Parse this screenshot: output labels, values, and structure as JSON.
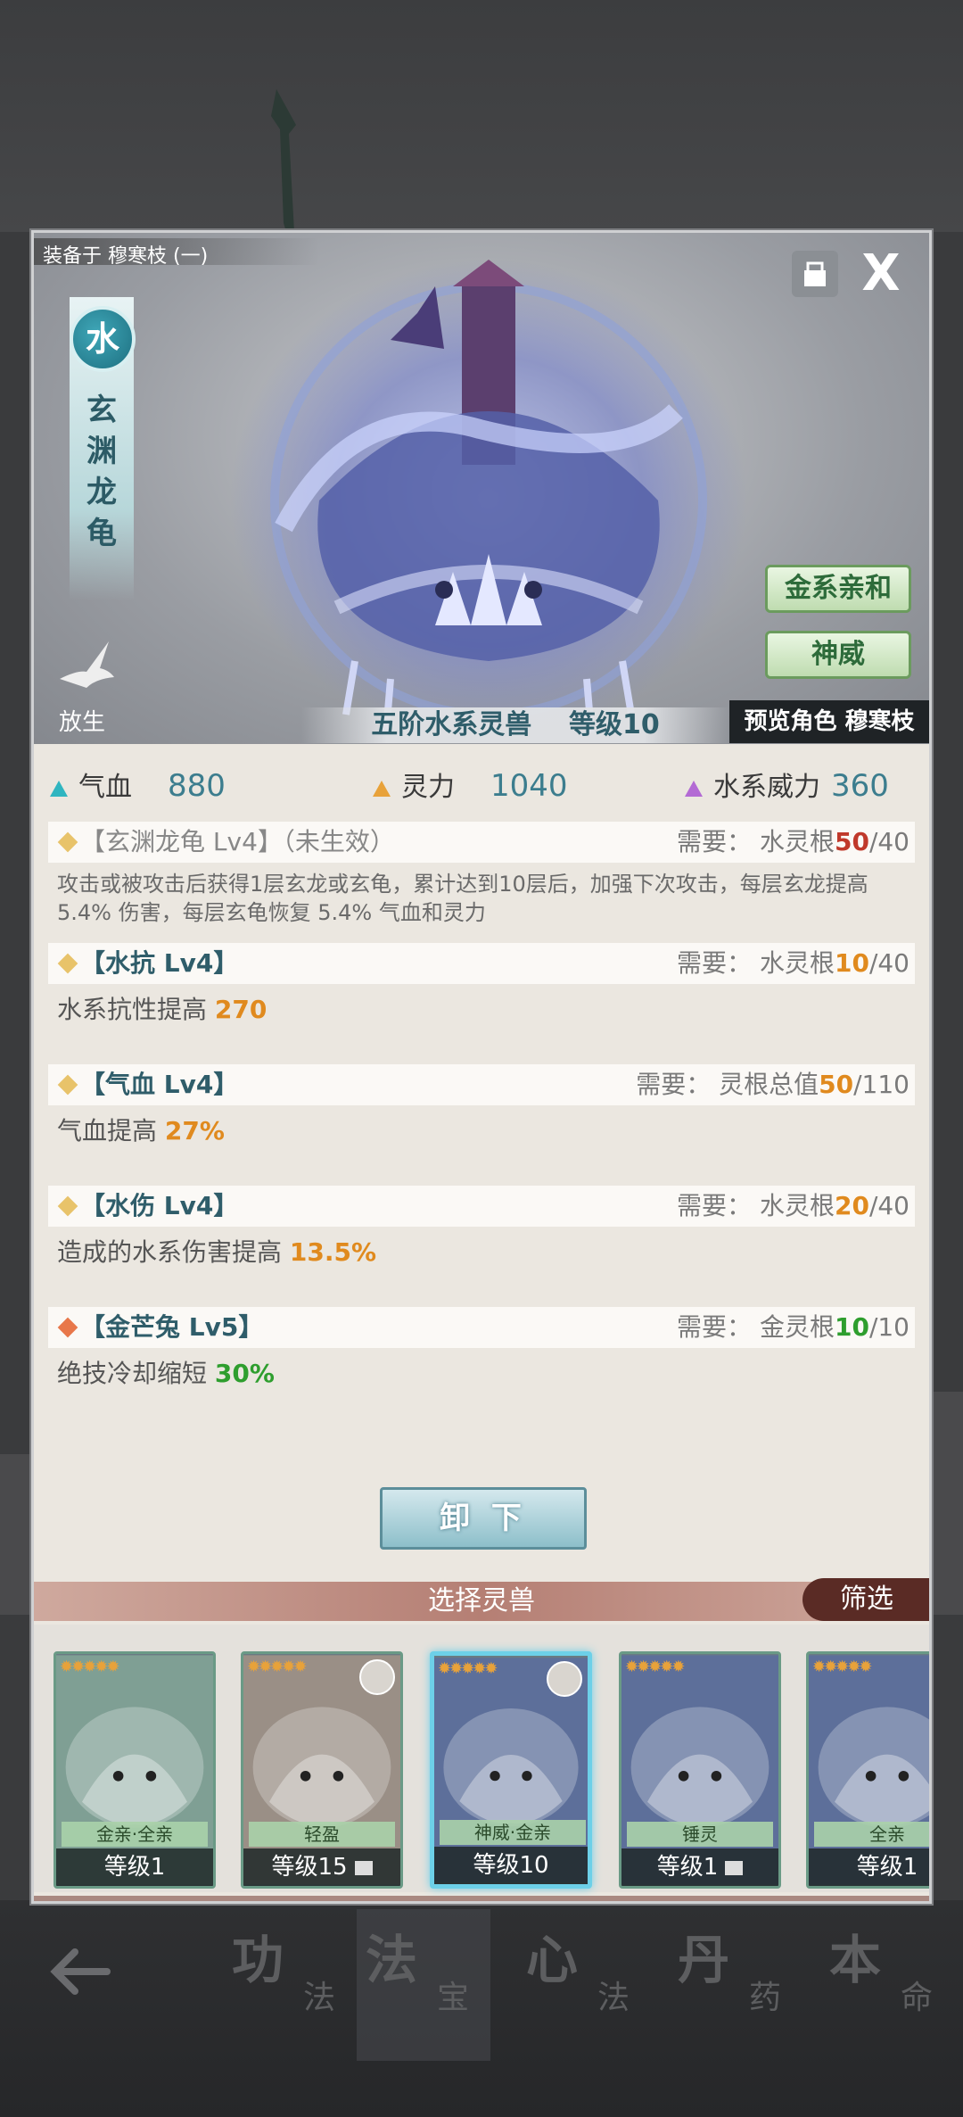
{
  "dialog": {
    "equipped_label": "装备于 穆寒枝 (一)",
    "element": "水",
    "beast_name": "玄渊龙龟",
    "close_label": "X",
    "release_label": "放生",
    "side_buttons": [
      "金系亲和",
      "神威"
    ],
    "banner": "五阶水系灵兽    等级10",
    "preview_label": "预览角色 穆寒枝"
  },
  "stats": [
    {
      "label": "气血",
      "value": "880",
      "color": "#2fb5c0"
    },
    {
      "label": "灵力",
      "value": "1040",
      "color": "#e8a23a"
    },
    {
      "label": "水系威力",
      "value": "360",
      "color": "#b36ad4"
    }
  ],
  "skills": [
    {
      "name": "【玄渊龙龟 Lv4】（未生效）",
      "req_label": "需要：",
      "req_attr": "水灵根",
      "req_cur": "50",
      "req_max": "/40",
      "cur_color": "#c0392b",
      "dot_color": "#e8c36a",
      "grey": true,
      "desc_pre": "攻击或被攻击后获得1层玄龙或玄龟，累计达到10层后，加强下次攻击，每层玄龙提高 5.4% 伤害，每层玄龟恢复 5.4% 气血和灵力",
      "desc_hl": "",
      "hl_color": ""
    },
    {
      "name": "【水抗 Lv4】",
      "req_label": "需要：",
      "req_attr": "水灵根",
      "req_cur": "10",
      "req_max": "/40",
      "cur_color": "#e08a1e",
      "dot_color": "#e8c36a",
      "grey": false,
      "desc_pre": "水系抗性提高 ",
      "desc_hl": "270",
      "hl_color": "#e08a1e"
    },
    {
      "name": "【气血 Lv4】",
      "req_label": "需要：",
      "req_attr": "灵根总值",
      "req_cur": "50",
      "req_max": "/110",
      "cur_color": "#e08a1e",
      "dot_color": "#e8c36a",
      "grey": false,
      "desc_pre": "气血提高 ",
      "desc_hl": "27%",
      "hl_color": "#e08a1e"
    },
    {
      "name": "【水伤 Lv4】",
      "req_label": "需要：",
      "req_attr": "水灵根",
      "req_cur": "20",
      "req_max": "/40",
      "cur_color": "#e08a1e",
      "dot_color": "#e8c36a",
      "grey": false,
      "desc_pre": "造成的水系伤害提高 ",
      "desc_hl": "13.5%",
      "hl_color": "#e08a1e"
    },
    {
      "name": "【金芒兔 Lv5】",
      "req_label": "需要：",
      "req_attr": "金灵根",
      "req_cur": "10",
      "req_max": "/10",
      "cur_color": "#2e9e2e",
      "dot_color": "#e8774a",
      "grey": false,
      "desc_pre": "绝技冷却缩短 ",
      "desc_hl": "30%",
      "hl_color": "#2e9e2e"
    }
  ],
  "unequip_label": "卸 下",
  "select_title": "选择灵兽",
  "filter_label": "筛选",
  "pets": [
    {
      "stars": "✹✹✹✹✹",
      "tags": "金亲·全亲",
      "level": "等级1",
      "locked": false,
      "selected": false,
      "avatar": false,
      "bg": "#7f9f94"
    },
    {
      "stars": "✹✹✹✹✹",
      "tags": "轻盈",
      "level": "等级15",
      "locked": true,
      "selected": false,
      "avatar": true,
      "bg": "#9a8f86"
    },
    {
      "stars": "✹✹✹✹✹",
      "tags": "神威·金亲",
      "level": "等级10",
      "locked": false,
      "selected": true,
      "avatar": true,
      "bg": "#5d6f9a"
    },
    {
      "stars": "✹✹✹✹✹",
      "tags": "锤灵",
      "level": "等级1",
      "locked": true,
      "selected": false,
      "avatar": false,
      "bg": "#5d6f9a"
    },
    {
      "stars": "✹✹✹✹✹",
      "tags": "全亲",
      "level": "等级1",
      "locked": false,
      "selected": false,
      "avatar": false,
      "bg": "#5d6f9a"
    }
  ],
  "bottom_nav": [
    {
      "big": "功",
      "small": "法"
    },
    {
      "big": "法",
      "small": "宝"
    },
    {
      "big": "心",
      "small": "法"
    },
    {
      "big": "丹",
      "small": "药"
    },
    {
      "big": "本",
      "small": "命"
    }
  ]
}
